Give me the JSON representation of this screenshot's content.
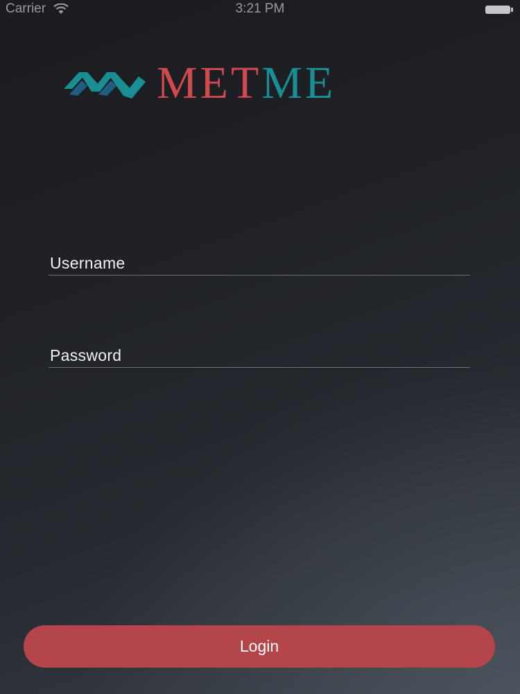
{
  "status_bar": {
    "carrier": "Carrier",
    "time": "3:21 PM",
    "wifi_icon": "wifi-icon",
    "battery_icon": "battery-icon"
  },
  "logo": {
    "text_part1": "MET",
    "text_part2": "ME",
    "mark_icon": "metme-logo-mark",
    "colors": {
      "red": "#d0494f",
      "teal": "#1a8f93",
      "teal_dark": "#16727a"
    }
  },
  "form": {
    "username": {
      "placeholder": "Username",
      "value": ""
    },
    "password": {
      "placeholder": "Password",
      "value": ""
    }
  },
  "login_button": {
    "label": "Login",
    "color": "#b4464b"
  }
}
